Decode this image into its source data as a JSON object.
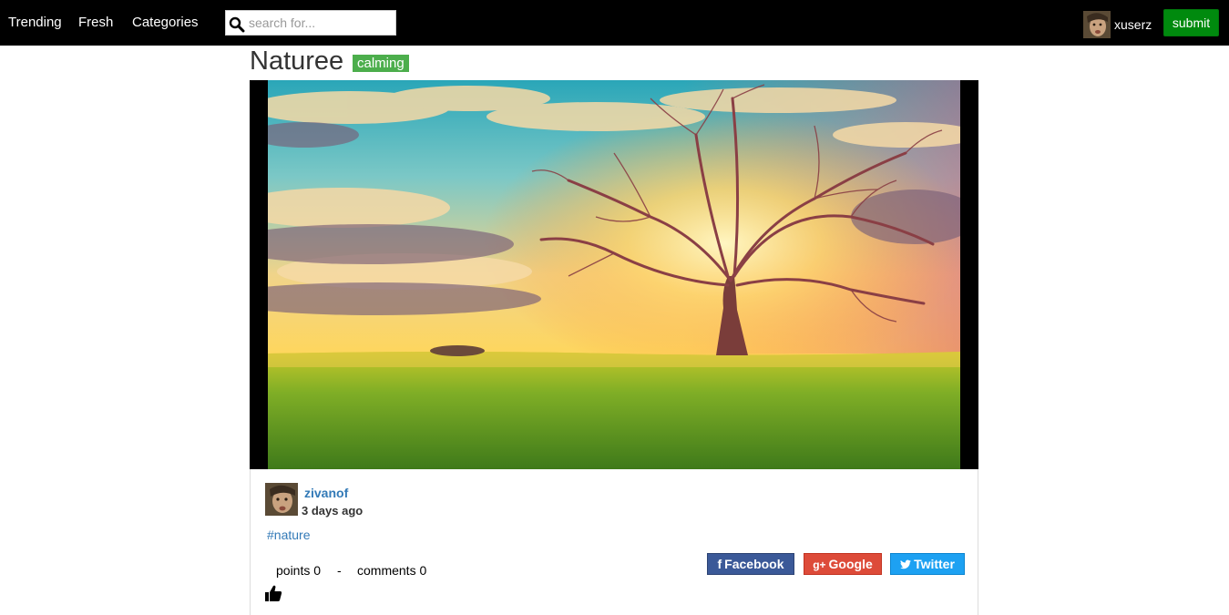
{
  "nav": {
    "links": [
      "Trending",
      "Fresh",
      "Categories"
    ],
    "search_placeholder": "search for...",
    "username": "xuserz",
    "submit_label": "submit"
  },
  "post": {
    "title": "Naturee",
    "badge": "calming",
    "author": "zivanof",
    "time": "3 days ago",
    "tag": "#nature",
    "points_label": "points 0",
    "separator": "-",
    "comments_label": "comments 0"
  },
  "share": {
    "facebook": {
      "label": "Facebook",
      "color": "#3b5998"
    },
    "google": {
      "label": "Google",
      "glyph": "g+",
      "color": "#dd4b39"
    },
    "twitter": {
      "label": "Twitter",
      "color": "#1da1f2"
    }
  },
  "colors": {
    "navbar": "#000000",
    "submit": "#008a0e",
    "badge": "#4cae4c",
    "link": "#337ab7"
  },
  "icons": {
    "search": "search-icon",
    "like": "thumbs-up-icon",
    "facebook": "facebook-icon",
    "twitter": "twitter-icon"
  }
}
